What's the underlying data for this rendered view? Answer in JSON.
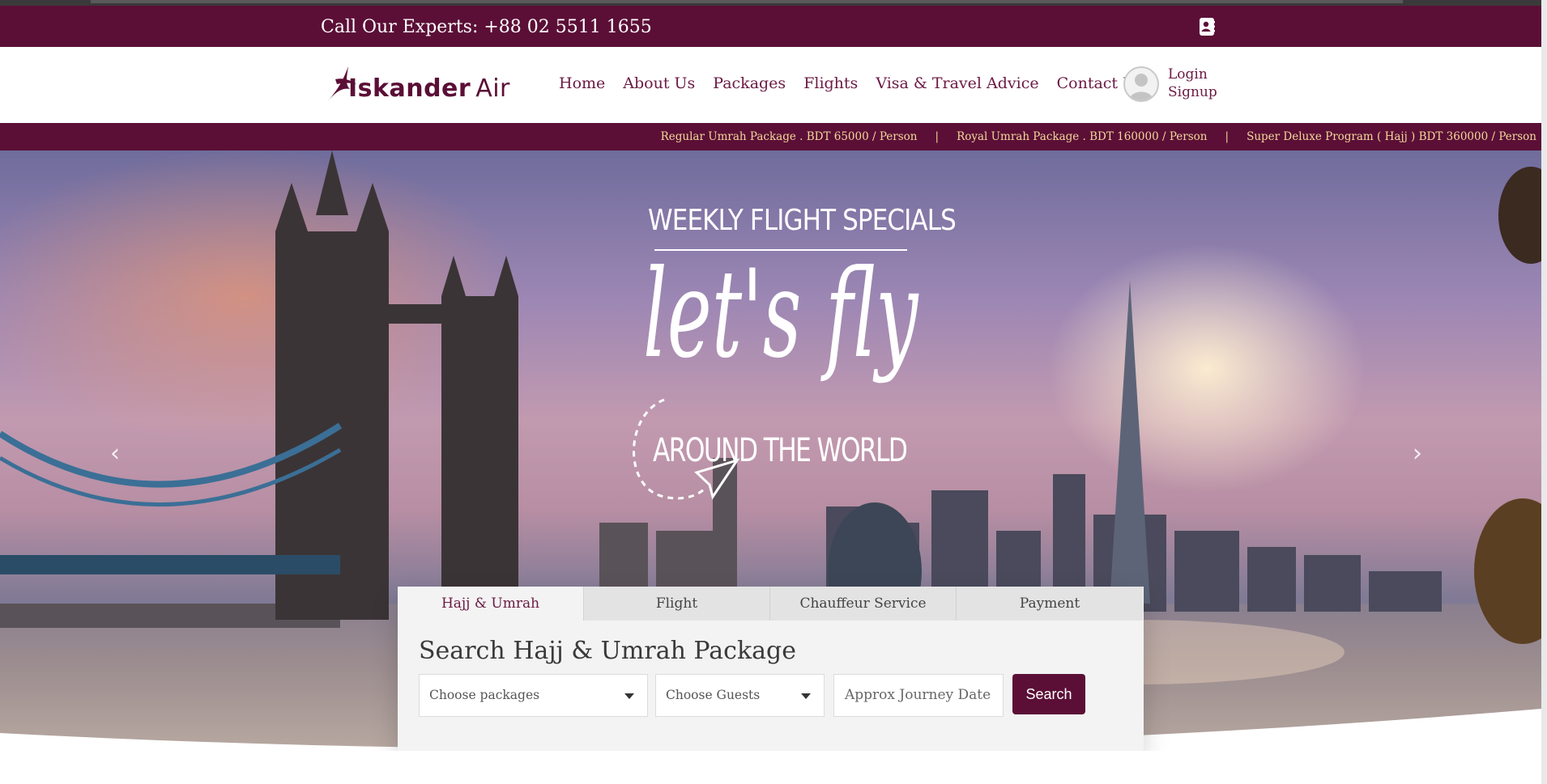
{
  "topbar": {
    "phone": "Call Our Experts: +88 02 5511 1655",
    "contact_icon": "contact-card-icon",
    "bg_color": "#5b0f36"
  },
  "header": {
    "logo": {
      "brand": "Iskander",
      "suffix": "Air"
    },
    "nav": [
      "Home",
      "About Us",
      "Packages",
      "Flights",
      "Visa & Travel Advice",
      "Contact Us"
    ],
    "account": {
      "login": "Login",
      "signup": "Signup",
      "avatar_icon": "user-avatar-icon"
    }
  },
  "ticker": {
    "items": [
      "Regular Umrah Package . BDT 65000 / Person",
      "Royal Umrah Package . BDT 160000 / Person",
      "Super Deluxe Program ( Hajj ) BDT 360000 / Person"
    ],
    "separator": "|",
    "text_color": "#f2d89a"
  },
  "hero": {
    "heading": "WEEKLY FLIGHT SPECIALS",
    "tagline": "let's fly",
    "subheading": "AROUND THE WORLD",
    "prev_icon": "chevron-left-icon",
    "next_icon": "chevron-right-icon"
  },
  "search": {
    "tabs": [
      "Hajj & Umrah",
      "Flight",
      "Chauffeur Service",
      "Payment"
    ],
    "active_tab": 0,
    "title": "Search Hajj & Umrah Package",
    "packages_placeholder": "Choose packages",
    "guests_placeholder": "Choose Guests",
    "date_placeholder": "Approx Journey Date",
    "button": "Search",
    "accent": "#5b0f36"
  }
}
